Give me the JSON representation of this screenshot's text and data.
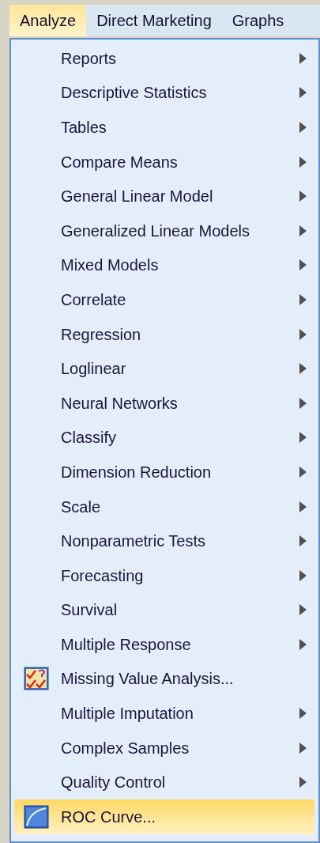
{
  "menu_bar": [
    {
      "label": "Analyze",
      "selected": true
    },
    {
      "label": "Direct Marketing",
      "selected": false
    },
    {
      "label": "Graphs",
      "selected": false
    }
  ],
  "menu": [
    {
      "label": "Reports",
      "kind": "submenu",
      "selected": false
    },
    {
      "label": "Descriptive Statistics",
      "kind": "submenu",
      "selected": false
    },
    {
      "label": "Tables",
      "kind": "submenu",
      "selected": false
    },
    {
      "label": "Compare Means",
      "kind": "submenu",
      "selected": false
    },
    {
      "label": "General Linear Model",
      "kind": "submenu",
      "selected": false
    },
    {
      "label": "Generalized Linear Models",
      "kind": "submenu",
      "selected": false
    },
    {
      "label": "Mixed Models",
      "kind": "submenu",
      "selected": false
    },
    {
      "label": "Correlate",
      "kind": "submenu",
      "selected": false
    },
    {
      "label": "Regression",
      "kind": "submenu",
      "selected": false
    },
    {
      "label": "Loglinear",
      "kind": "submenu",
      "selected": false
    },
    {
      "label": "Neural Networks",
      "kind": "submenu",
      "selected": false
    },
    {
      "label": "Classify",
      "kind": "submenu",
      "selected": false
    },
    {
      "label": "Dimension Reduction",
      "kind": "submenu",
      "selected": false
    },
    {
      "label": "Scale",
      "kind": "submenu",
      "selected": false
    },
    {
      "label": "Nonparametric Tests",
      "kind": "submenu",
      "selected": false
    },
    {
      "label": "Forecasting",
      "kind": "submenu",
      "selected": false
    },
    {
      "label": "Survival",
      "kind": "submenu",
      "selected": false
    },
    {
      "label": "Multiple Response",
      "kind": "submenu",
      "selected": false
    },
    {
      "label": "Missing Value Analysis...",
      "kind": "checklist_command",
      "selected": false
    },
    {
      "label": "Multiple Imputation",
      "kind": "submenu",
      "selected": false
    },
    {
      "label": "Complex Samples",
      "kind": "submenu",
      "selected": false
    },
    {
      "label": "Quality Control",
      "kind": "submenu",
      "selected": false
    },
    {
      "label": "ROC Curve...",
      "kind": "curve_command",
      "selected": true
    }
  ]
}
